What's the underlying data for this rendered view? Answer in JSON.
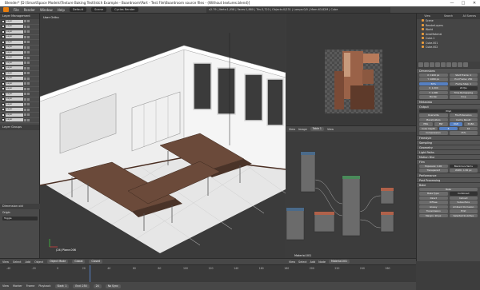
{
  "titlebar": {
    "title": "Blender* [D:\\SmartSpace Models\\Texture Baking Test\\Istch Example - Boardroom\\Part - Test File\\Boardroom source files - (Without textures.blend)]",
    "minimize": "—",
    "maximize": "□",
    "close": "✕"
  },
  "menubar": {
    "items": [
      "File",
      "Render",
      "Window",
      "Help"
    ],
    "layout_field": "Default",
    "scene_field": "Scene",
    "engine_field": "Cycles Render",
    "stats": "v2.79 | Verts:1,058 | Faces:1,880 | Tris:3,720 | Objects:0/231 | Lamps:0/0 | Mem:63.82M | Cube"
  },
  "leftpanel": {
    "header": "Layer Management",
    "layer_names": [
      "Layer",
      "Layer",
      "Layer",
      "Layer",
      "Layer",
      "Layer",
      "Layer",
      "Layer",
      "Layer",
      "Layer",
      "Layer",
      "Layer",
      "Layer",
      "Layer",
      "Layer",
      "Layer",
      "Layer",
      "Layer",
      "Layer",
      "Layer"
    ],
    "layer_groups": "Layer Groups",
    "dimension": "Dimension old",
    "origin": "Origin",
    "toggle": "Toggle"
  },
  "viewport": {
    "view_label": "User Ortho",
    "object_label": "(24) Plane.006"
  },
  "imageeditor": {
    "view": "View",
    "image": "Image",
    "image_name": "Table 1",
    "view2": "View"
  },
  "nodeeditor": {
    "label": "Material.001"
  },
  "v3dheader": {
    "items": [
      "View",
      "Select",
      "Add",
      "Object"
    ],
    "mode": "Object Mode",
    "pivot": "Global",
    "layer": "Closed"
  },
  "nodehdr": {
    "items": [
      "View",
      "Select",
      "Add",
      "Node"
    ],
    "material": "Material.001"
  },
  "outliner": {
    "tabs": [
      "View",
      "Search",
      "All Scenes"
    ],
    "items": [
      "Scene",
      "RenderLayers",
      "World",
      "AreaMaterial",
      "Cube.1",
      "Cube.001",
      "Cube.002"
    ]
  },
  "properties": {
    "sections": {
      "dimensions": "Dimensions",
      "resolution_x": "X: 1920 px",
      "resolution_y": "Y: 1080 px",
      "percent": "50%",
      "start_frame": "Start Frame: 1",
      "end_frame": "End Frame: 250",
      "frame_step": "Frame Step: 1",
      "aspect_x": "X: 1.000",
      "aspect_y": "Y: 1.000",
      "fps": "24 fps",
      "time_remap": "Time Remapping",
      "border": "Border",
      "crop": "Crop",
      "metadata": "Metadata",
      "output": "Output",
      "output_path": "/tmp\\",
      "overwrite": "Overwrite",
      "file_ext": "File Extensions",
      "placeholders": "Placeholders",
      "cache_result": "Cache Result",
      "format": "PNG",
      "bw": "BW",
      "rgb": "RGB",
      "rgba": "RGBA",
      "color_depth": "Color Depth",
      "depth8": "8",
      "depth16": "16",
      "compression": "Compression:",
      "compression_val": "15%",
      "freestyle": "Freestyle",
      "sampling": "Sampling",
      "geometry": "Geometry",
      "light_paths": "Light Paths",
      "motion_blur": "Motion Blur",
      "film": "Film",
      "exposure": "Exposure: 1.00",
      "filter": "Blackman-Harris",
      "transparent": "Transparent",
      "filter_width": "Width: 1.50 px",
      "performance": "Performance",
      "post_processing": "Post Processing",
      "bake": "Bake",
      "bake_button": "Bake",
      "bake_type": "Bake Type:",
      "bake_type_val": "Combined",
      "direct": "Direct",
      "indirect": "Indirect",
      "color": "Color",
      "diffuse": "Diffuse",
      "glossy": "Glossy",
      "transmission": "Transmission",
      "subsurface": "Subsurface",
      "ao": "Ambient Occlusion",
      "emit": "Emit",
      "margin": "Margin: 16 px",
      "selected_to_active": "Selected to Active"
    }
  },
  "timeline": {
    "ticks": [
      "-40",
      "-20",
      "0",
      "20",
      "40",
      "60",
      "80",
      "100",
      "120",
      "140",
      "160",
      "180",
      "200",
      "220",
      "240",
      "260"
    ],
    "items": [
      "View",
      "Marker",
      "Frame",
      "Playback"
    ],
    "start": "Start: 1",
    "end": "End: 250",
    "current": "24",
    "sync": "No Sync"
  },
  "colors": {
    "table_wood": "#6b4a3a",
    "wall": "#f2f2f2",
    "floor": "#eaeaea",
    "accent_blue": "#5680c2"
  }
}
